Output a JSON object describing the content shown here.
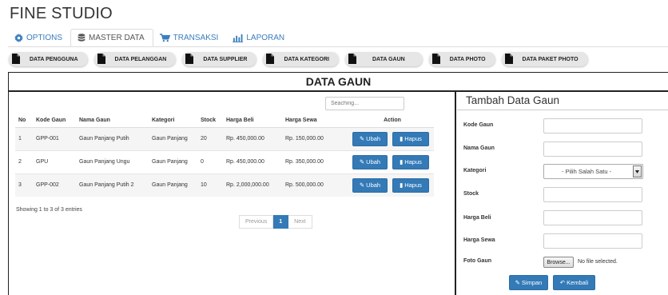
{
  "app": {
    "title": "FINE STUDIO"
  },
  "nav": {
    "tabs": [
      {
        "label": "OPTIONS",
        "icon": "gear-icon"
      },
      {
        "label": "MASTER DATA",
        "icon": "database-icon"
      },
      {
        "label": "TRANSAKSI",
        "icon": "cart-icon"
      },
      {
        "label": "LAPORAN",
        "icon": "bar-chart-icon"
      }
    ],
    "active": "MASTER DATA"
  },
  "subnav": {
    "items": [
      "DATA PENGGUNA",
      "DATA PELANGGAN",
      "DATA SUPPLIER",
      "DATA KATEGORI",
      "DATA GAUN",
      "DATA PHOTO",
      "DATA PAKET PHOTO"
    ]
  },
  "panel": {
    "title": "DATA GAUN"
  },
  "search": {
    "placeholder": "Seaching..."
  },
  "table": {
    "columns": [
      "No",
      "Kode Gaun",
      "Nama Gaun",
      "Kategori",
      "Stock",
      "Harga Beli",
      "Harga Sewa",
      "Action"
    ],
    "rows": [
      {
        "no": "1",
        "kode": "GPP-001",
        "nama": "Gaun Panjang Putih",
        "kategori": "Gaun Panjang",
        "stock": "20",
        "beli": "Rp. 450,000.00",
        "sewa": "Rp. 150,000.00"
      },
      {
        "no": "2",
        "kode": "GPU",
        "nama": "Gaun Panjang Ungu",
        "kategori": "Gaun Panjang",
        "stock": "0",
        "beli": "Rp. 450,000.00",
        "sewa": "Rp. 350,000.00"
      },
      {
        "no": "3",
        "kode": "GPP-002",
        "nama": "Gaun Panjang Putih 2",
        "kategori": "Gaun Panjang",
        "stock": "10",
        "beli": "Rp. 2,000,000.00",
        "sewa": "Rp. 500,000.00"
      }
    ],
    "edit_label": "Ubah",
    "delete_label": "Hapus"
  },
  "footer": {
    "showing": "Showing 1 to 3 of 3 entries",
    "pagination": {
      "previous": "Previous",
      "current": "1",
      "next": "Next"
    }
  },
  "form": {
    "title": "Tambah Data Gaun",
    "fields": {
      "kode": "Kode Gaun",
      "nama": "Nama Gaun",
      "kategori": "Kategori",
      "stock": "Stock",
      "beli": "Harga Beli",
      "sewa": "Harga Sewa",
      "foto": "Foto Gaun"
    },
    "kategori_selected": "- Pilih Salah Satu -",
    "browse_label": "Browse...",
    "file_status": "No file selected.",
    "save_label": "Simpan",
    "back_label": "Kembali"
  },
  "colors": {
    "primary": "#337ab7",
    "link": "#3a7dbd",
    "pill": "#e6e6e6"
  }
}
